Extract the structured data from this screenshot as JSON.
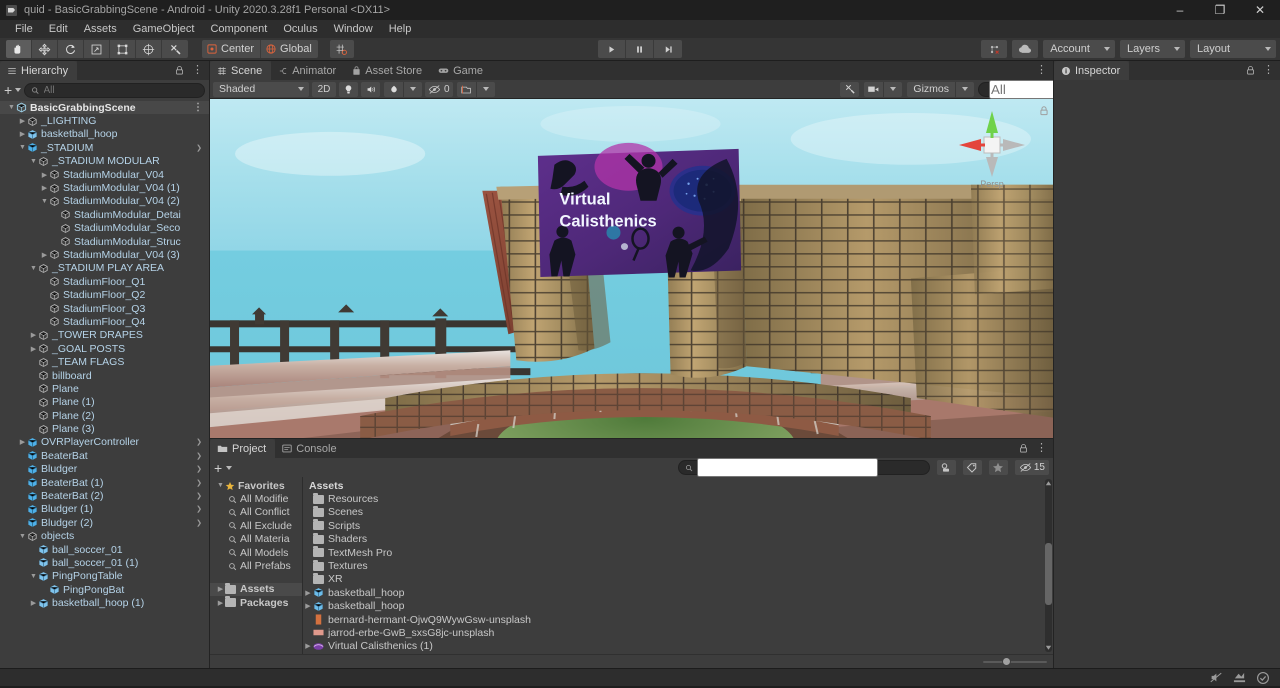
{
  "window": {
    "title": "quid - BasicGrabbingScene - Android - Unity 2020.3.28f1 Personal <DX11>",
    "minimize": "–",
    "maximize": "❐",
    "close": "✕"
  },
  "menubar": {
    "items": [
      "File",
      "Edit",
      "Assets",
      "GameObject",
      "Component",
      "Oculus",
      "Window",
      "Help"
    ]
  },
  "toolbar": {
    "tools": [
      {
        "name": "hand-tool",
        "selected": true
      },
      {
        "name": "move-tool",
        "selected": false
      },
      {
        "name": "rotate-tool",
        "selected": false
      },
      {
        "name": "scale-tool",
        "selected": false
      },
      {
        "name": "rect-tool",
        "selected": false
      },
      {
        "name": "transform-tool",
        "selected": false
      },
      {
        "name": "custom-editor-tool",
        "selected": false
      }
    ],
    "pivot_label": "Center",
    "space_label": "Global",
    "play": "▶",
    "pause": "❚❚",
    "step": "▶|",
    "collab_label": "",
    "cloud_label": "",
    "account_label": "Account",
    "layers_label": "Layers",
    "layout_label": "Layout"
  },
  "hierarchy": {
    "tab_label": "Hierarchy",
    "search_placeholder": "All",
    "add_label": "+",
    "items": [
      {
        "label": "BasicGrabbingScene",
        "depth": 0,
        "icon": "scene",
        "arrow": "down",
        "scene": true,
        "kebab": true
      },
      {
        "label": "_LIGHTING",
        "depth": 1,
        "icon": "go",
        "arrow": "right"
      },
      {
        "label": "basketball_hoop",
        "depth": 1,
        "icon": "prefab",
        "arrow": "right"
      },
      {
        "label": "_STADIUM",
        "depth": 1,
        "icon": "prefab-blue",
        "arrow": "down",
        "chevron": true
      },
      {
        "label": "_STADIUM MODULAR",
        "depth": 2,
        "icon": "go",
        "arrow": "down"
      },
      {
        "label": "StadiumModular_V04",
        "depth": 3,
        "icon": "go",
        "arrow": "right"
      },
      {
        "label": "StadiumModular_V04 (1)",
        "depth": 3,
        "icon": "go",
        "arrow": "right"
      },
      {
        "label": "StadiumModular_V04 (2)",
        "depth": 3,
        "icon": "go",
        "arrow": "down"
      },
      {
        "label": "StadiumModular_Detai",
        "depth": 4,
        "icon": "go",
        "arrow": ""
      },
      {
        "label": "StadiumModular_Seco",
        "depth": 4,
        "icon": "go",
        "arrow": ""
      },
      {
        "label": "StadiumModular_Struc",
        "depth": 4,
        "icon": "go",
        "arrow": ""
      },
      {
        "label": "StadiumModular_V04 (3)",
        "depth": 3,
        "icon": "go",
        "arrow": "right"
      },
      {
        "label": "_STADIUM PLAY AREA",
        "depth": 2,
        "icon": "go",
        "arrow": "down"
      },
      {
        "label": "StadiumFloor_Q1",
        "depth": 3,
        "icon": "go",
        "arrow": ""
      },
      {
        "label": "StadiumFloor_Q2",
        "depth": 3,
        "icon": "go",
        "arrow": ""
      },
      {
        "label": "StadiumFloor_Q3",
        "depth": 3,
        "icon": "go",
        "arrow": ""
      },
      {
        "label": "StadiumFloor_Q4",
        "depth": 3,
        "icon": "go",
        "arrow": ""
      },
      {
        "label": "_TOWER DRAPES",
        "depth": 2,
        "icon": "go",
        "arrow": "right"
      },
      {
        "label": "_GOAL POSTS",
        "depth": 2,
        "icon": "go",
        "arrow": "right"
      },
      {
        "label": "_TEAM FLAGS",
        "depth": 2,
        "icon": "go",
        "arrow": ""
      },
      {
        "label": "billboard",
        "depth": 2,
        "icon": "go",
        "arrow": ""
      },
      {
        "label": "Plane",
        "depth": 2,
        "icon": "go",
        "arrow": ""
      },
      {
        "label": "Plane (1)",
        "depth": 2,
        "icon": "go",
        "arrow": ""
      },
      {
        "label": "Plane (2)",
        "depth": 2,
        "icon": "go",
        "arrow": ""
      },
      {
        "label": "Plane (3)",
        "depth": 2,
        "icon": "go",
        "arrow": ""
      },
      {
        "label": "OVRPlayerController",
        "depth": 1,
        "icon": "prefab-blue",
        "arrow": "right",
        "chevron": true
      },
      {
        "label": "BeaterBat",
        "depth": 1,
        "icon": "prefab-blue",
        "arrow": "",
        "chevron": true
      },
      {
        "label": "Bludger",
        "depth": 1,
        "icon": "prefab-blue",
        "arrow": "",
        "chevron": true
      },
      {
        "label": "BeaterBat (1)",
        "depth": 1,
        "icon": "prefab-blue",
        "arrow": "",
        "chevron": true
      },
      {
        "label": "BeaterBat (2)",
        "depth": 1,
        "icon": "prefab-blue",
        "arrow": "",
        "chevron": true
      },
      {
        "label": "Bludger (1)",
        "depth": 1,
        "icon": "prefab-blue",
        "arrow": "",
        "chevron": true
      },
      {
        "label": "Bludger (2)",
        "depth": 1,
        "icon": "prefab-blue",
        "arrow": "",
        "chevron": true
      },
      {
        "label": "objects",
        "depth": 1,
        "icon": "go",
        "arrow": "down"
      },
      {
        "label": "ball_soccer_01",
        "depth": 2,
        "icon": "prefab",
        "arrow": ""
      },
      {
        "label": "ball_soccer_01 (1)",
        "depth": 2,
        "icon": "prefab",
        "arrow": ""
      },
      {
        "label": "PingPongTable",
        "depth": 2,
        "icon": "prefab",
        "arrow": "down"
      },
      {
        "label": "PingPongBat",
        "depth": 3,
        "icon": "prefab",
        "arrow": ""
      },
      {
        "label": "basketball_hoop (1)",
        "depth": 2,
        "icon": "prefab",
        "arrow": "right"
      }
    ]
  },
  "scene": {
    "tabs": [
      {
        "label": "Scene",
        "icon": "scene-icon",
        "active": true
      },
      {
        "label": "Animator",
        "icon": "animator-icon",
        "active": false
      },
      {
        "label": "Asset Store",
        "icon": "store-icon",
        "active": false
      },
      {
        "label": "Game",
        "icon": "game-icon",
        "active": false
      }
    ],
    "draw_mode": "Shaded",
    "mode_2d": "2D",
    "effects_count": "0",
    "gizmos_label": "Gizmos",
    "gizmo_search_placeholder": "All",
    "orientation_label": "Persp",
    "billboard_title_line1": "Virtual",
    "billboard_title_line2": "Calisthenics"
  },
  "project": {
    "tabs": [
      {
        "label": "Project",
        "icon": "folder-icon",
        "active": true
      },
      {
        "label": "Console",
        "icon": "console-icon",
        "active": false
      }
    ],
    "add_label": "+",
    "search_placeholder": "",
    "hidden_count": "15",
    "favorites_label": "Favorites",
    "favorites": [
      "All Modifie",
      "All Conflict",
      "All Exclude",
      "All Materia",
      "All Models",
      "All Prefabs"
    ],
    "tree_roots": [
      {
        "label": "Assets",
        "selected": true
      },
      {
        "label": "Packages",
        "selected": false
      }
    ],
    "assets_header": "Assets",
    "assets": [
      {
        "label": "Resources",
        "type": "folder",
        "arrow": false
      },
      {
        "label": "Scenes",
        "type": "folder",
        "arrow": false
      },
      {
        "label": "Scripts",
        "type": "folder",
        "arrow": false
      },
      {
        "label": "Shaders",
        "type": "folder",
        "arrow": false
      },
      {
        "label": "TextMesh Pro",
        "type": "folder",
        "arrow": false
      },
      {
        "label": "Textures",
        "type": "folder",
        "arrow": false
      },
      {
        "label": "XR",
        "type": "folder",
        "arrow": false
      },
      {
        "label": "basketball_hoop",
        "type": "prefab",
        "arrow": true
      },
      {
        "label": "basketball_hoop",
        "type": "prefab",
        "arrow": true
      },
      {
        "label": "bernard-hermant-OjwQ9WywGsw-unsplash",
        "type": "texture-orange",
        "arrow": false
      },
      {
        "label": "jarrod-erbe-GwB_sxsG8jc-unsplash",
        "type": "texture-pink",
        "arrow": false
      },
      {
        "label": "Virtual Calisthenics (1)",
        "type": "material-purple",
        "arrow": true
      }
    ]
  },
  "inspector": {
    "tab_label": "Inspector"
  },
  "statusbar": {
    "icons": [
      "mute-audio-icon",
      "stats-icon",
      "ready-check-icon"
    ]
  },
  "colors": {
    "panel_bg": "#383838",
    "panel_body": "#3d3d3d",
    "toolbar_bg": "#353535",
    "tab_inactive": "#303030",
    "hierarchy_text": "#b5d3e8",
    "billboard_purple": "#5b2d86",
    "sky": "#a9e2ec",
    "grass": "#7a9e5e"
  }
}
